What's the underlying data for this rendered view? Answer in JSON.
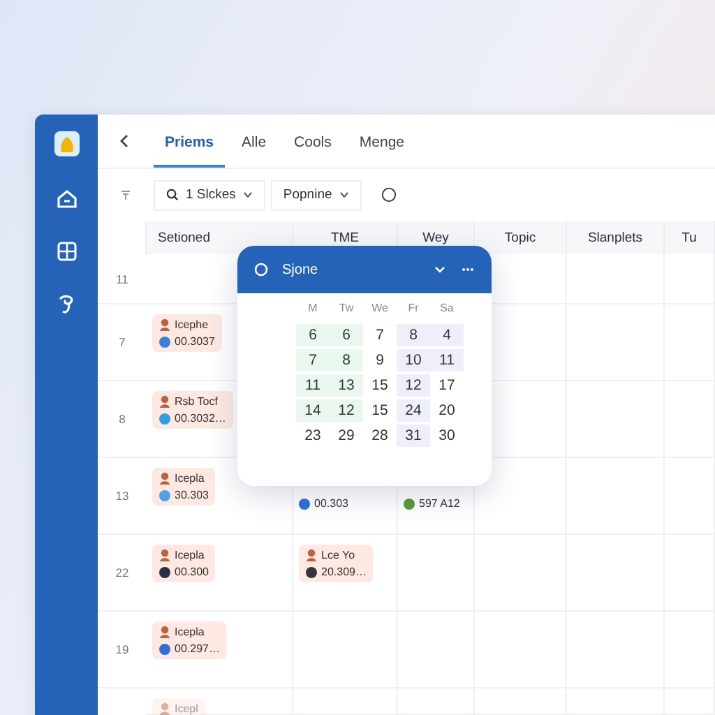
{
  "tabs": [
    {
      "label": "Priems",
      "selected": true
    },
    {
      "label": "Alle",
      "selected": false
    },
    {
      "label": "Cools",
      "selected": false
    },
    {
      "label": "Menge",
      "selected": false
    }
  ],
  "toolbar": {
    "filters": [
      {
        "label": "1 Slckes",
        "kind": "search"
      },
      {
        "label": "Popnine",
        "kind": "plain"
      }
    ]
  },
  "table": {
    "columns": [
      "Setioned",
      "TME",
      "Wey",
      "Topic",
      "Slanplets",
      "Tu"
    ],
    "rows": [
      {
        "time": "11",
        "cells": [
          null,
          null,
          null,
          null,
          null,
          null
        ]
      },
      {
        "time": "7",
        "cells": [
          {
            "title": "Icephe",
            "faded": false,
            "code": "00.3037",
            "color": "#3d7fd9"
          },
          null,
          null,
          null,
          null,
          null
        ]
      },
      {
        "time": "8",
        "cells": [
          {
            "title": "Rsb Tocf",
            "faded": false,
            "code": "00.3032…",
            "color": "#2f9fe0"
          },
          null,
          null,
          null,
          null,
          null
        ]
      },
      {
        "time": "13",
        "cells": [
          {
            "title": "Icepla",
            "faded": false,
            "code": "30.303",
            "color": "#4aa3e8"
          },
          {
            "code": "00.303",
            "color": "#2f6fd6"
          },
          {
            "code": "597 A12",
            "color": "#5a9a3a"
          },
          null,
          null,
          null
        ]
      },
      {
        "time": "22",
        "cells": [
          {
            "title": "Icepla",
            "faded": false,
            "code": "00.300",
            "color": "#2b2f45"
          },
          {
            "title": "Lce Yo",
            "faded": false,
            "code": "20.309…",
            "color": "#33363d"
          },
          null,
          null,
          null,
          null
        ]
      },
      {
        "time": "19",
        "cells": [
          {
            "title": "Icepla",
            "faded": false,
            "code": "00.297…",
            "color": "#2f6fd6"
          },
          null,
          null,
          null,
          null,
          null
        ]
      },
      {
        "cells": [
          {
            "title": "Icepl",
            "faded": true
          },
          null,
          null,
          null,
          null,
          null
        ]
      }
    ]
  },
  "popup": {
    "title": "Sjone",
    "weekdays": [
      "M",
      "Tw",
      "We",
      "Fr",
      "Sa"
    ],
    "days": [
      {
        "label": "6",
        "color": "#eaf7ee"
      },
      {
        "label": "6",
        "color": "#eaf7ee"
      },
      {
        "label": "7"
      },
      {
        "label": "8",
        "color": "#efeefb"
      },
      {
        "label": "4",
        "color": "#efeefb"
      },
      {
        "label": "7",
        "color": "#eaf7ee"
      },
      {
        "label": "8",
        "color": "#eaf7ee"
      },
      {
        "label": "9"
      },
      {
        "label": "10",
        "color": "#efeefb"
      },
      {
        "label": "11",
        "color": "#efeefb"
      },
      {
        "label": "11",
        "color": "#eaf7ee"
      },
      {
        "label": "13",
        "color": "#eaf7ee"
      },
      {
        "label": "15"
      },
      {
        "label": "12",
        "color": "#efeefb"
      },
      {
        "label": "17"
      },
      {
        "label": "14",
        "color": "#eaf7ee"
      },
      {
        "label": "12",
        "color": "#eaf7ee"
      },
      {
        "label": "15"
      },
      {
        "label": "24",
        "color": "#efeefb"
      },
      {
        "label": "20"
      },
      {
        "label": "23"
      },
      {
        "label": "29"
      },
      {
        "label": "28"
      },
      {
        "label": "31",
        "color": "#efeefb"
      },
      {
        "label": "30"
      }
    ]
  }
}
